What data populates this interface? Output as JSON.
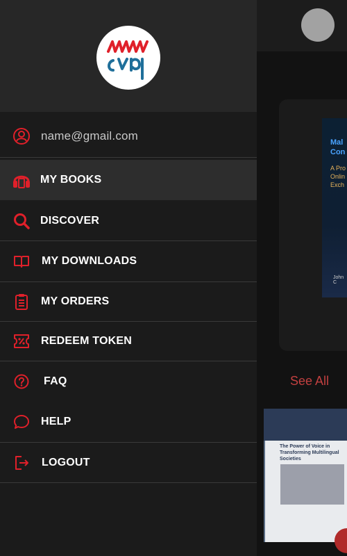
{
  "user": {
    "email": "name@gmail.com"
  },
  "menu": [
    {
      "id": "my-books",
      "label": "MY BOOKS",
      "icon": "headset-icon",
      "selected": true
    },
    {
      "id": "discover",
      "label": "DISCOVER",
      "icon": "search-icon",
      "selected": false
    },
    {
      "id": "my-downloads",
      "label": "MY DOWNLOADS",
      "icon": "book-open-icon",
      "selected": false
    },
    {
      "id": "my-orders",
      "label": "MY ORDERS",
      "icon": "clipboard-icon",
      "selected": false
    },
    {
      "id": "redeem-token",
      "label": "REDEEM TOKEN",
      "icon": "discount-ticket-icon",
      "selected": false
    },
    {
      "id": "faq",
      "label": "FAQ",
      "icon": "question-circle-icon",
      "selected": false
    },
    {
      "id": "help",
      "label": "HELP",
      "icon": "chat-bubble-icon",
      "selected": false
    },
    {
      "id": "logout",
      "label": "LOGOUT",
      "icon": "logout-icon",
      "selected": false
    }
  ],
  "background": {
    "see_all": "See All",
    "book1": {
      "title": "Mal Con",
      "subtitle": "A Pro Onlin Exch",
      "author": "John C"
    },
    "book2": {
      "title": "The Power of Voice in Transforming Multilingual Societies"
    }
  },
  "colors": {
    "accent": "#e0202a",
    "drawer_bg": "#1b1b1b",
    "header_bg": "#272727",
    "selected_bg": "#2d2d2d",
    "see_all": "#c24040"
  }
}
